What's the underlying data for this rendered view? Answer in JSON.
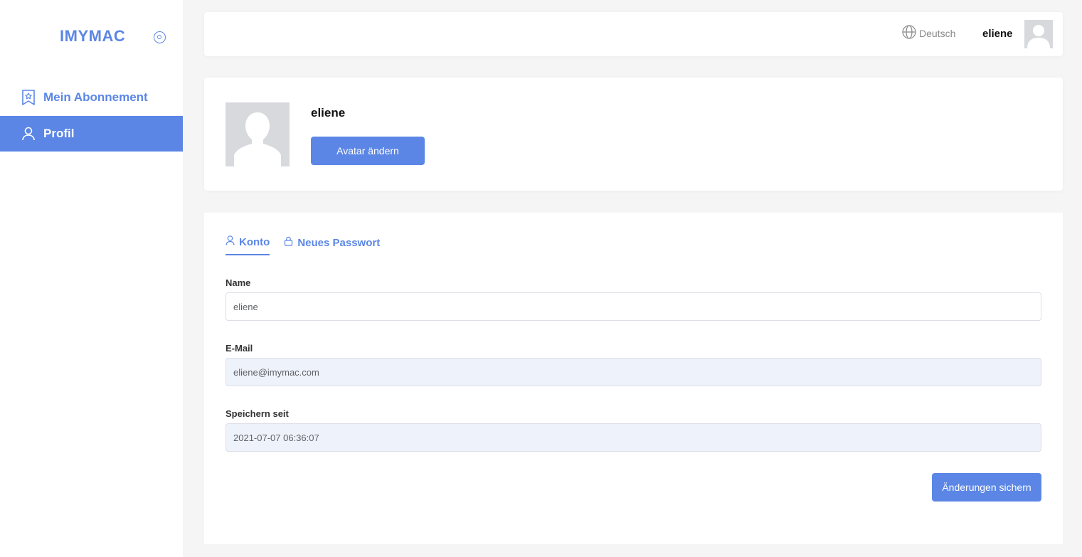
{
  "sidebar": {
    "logo": "IMYMAC",
    "items": [
      {
        "label": "Mein Abonnement",
        "icon": "bookmark-star-icon"
      },
      {
        "label": "Profil",
        "icon": "user-icon"
      }
    ]
  },
  "header": {
    "language": "Deutsch",
    "username": "eliene"
  },
  "profile": {
    "name": "eliene",
    "change_avatar_label": "Avatar ändern"
  },
  "tabs": [
    {
      "label": "Konto",
      "icon": "user-icon",
      "active": true
    },
    {
      "label": "Neues Passwort",
      "icon": "lock-icon",
      "active": false
    }
  ],
  "form": {
    "name_label": "Name",
    "name_value": "eliene",
    "email_label": "E-Mail",
    "email_value": "eliene@imymac.com",
    "since_label": "Speichern seit",
    "since_value": "2021-07-07 06:36:07",
    "save_label": "Änderungen sichern"
  },
  "colors": {
    "accent": "#5b86e5",
    "background": "#f5f5f5",
    "readonly_field": "#eef2fb"
  }
}
